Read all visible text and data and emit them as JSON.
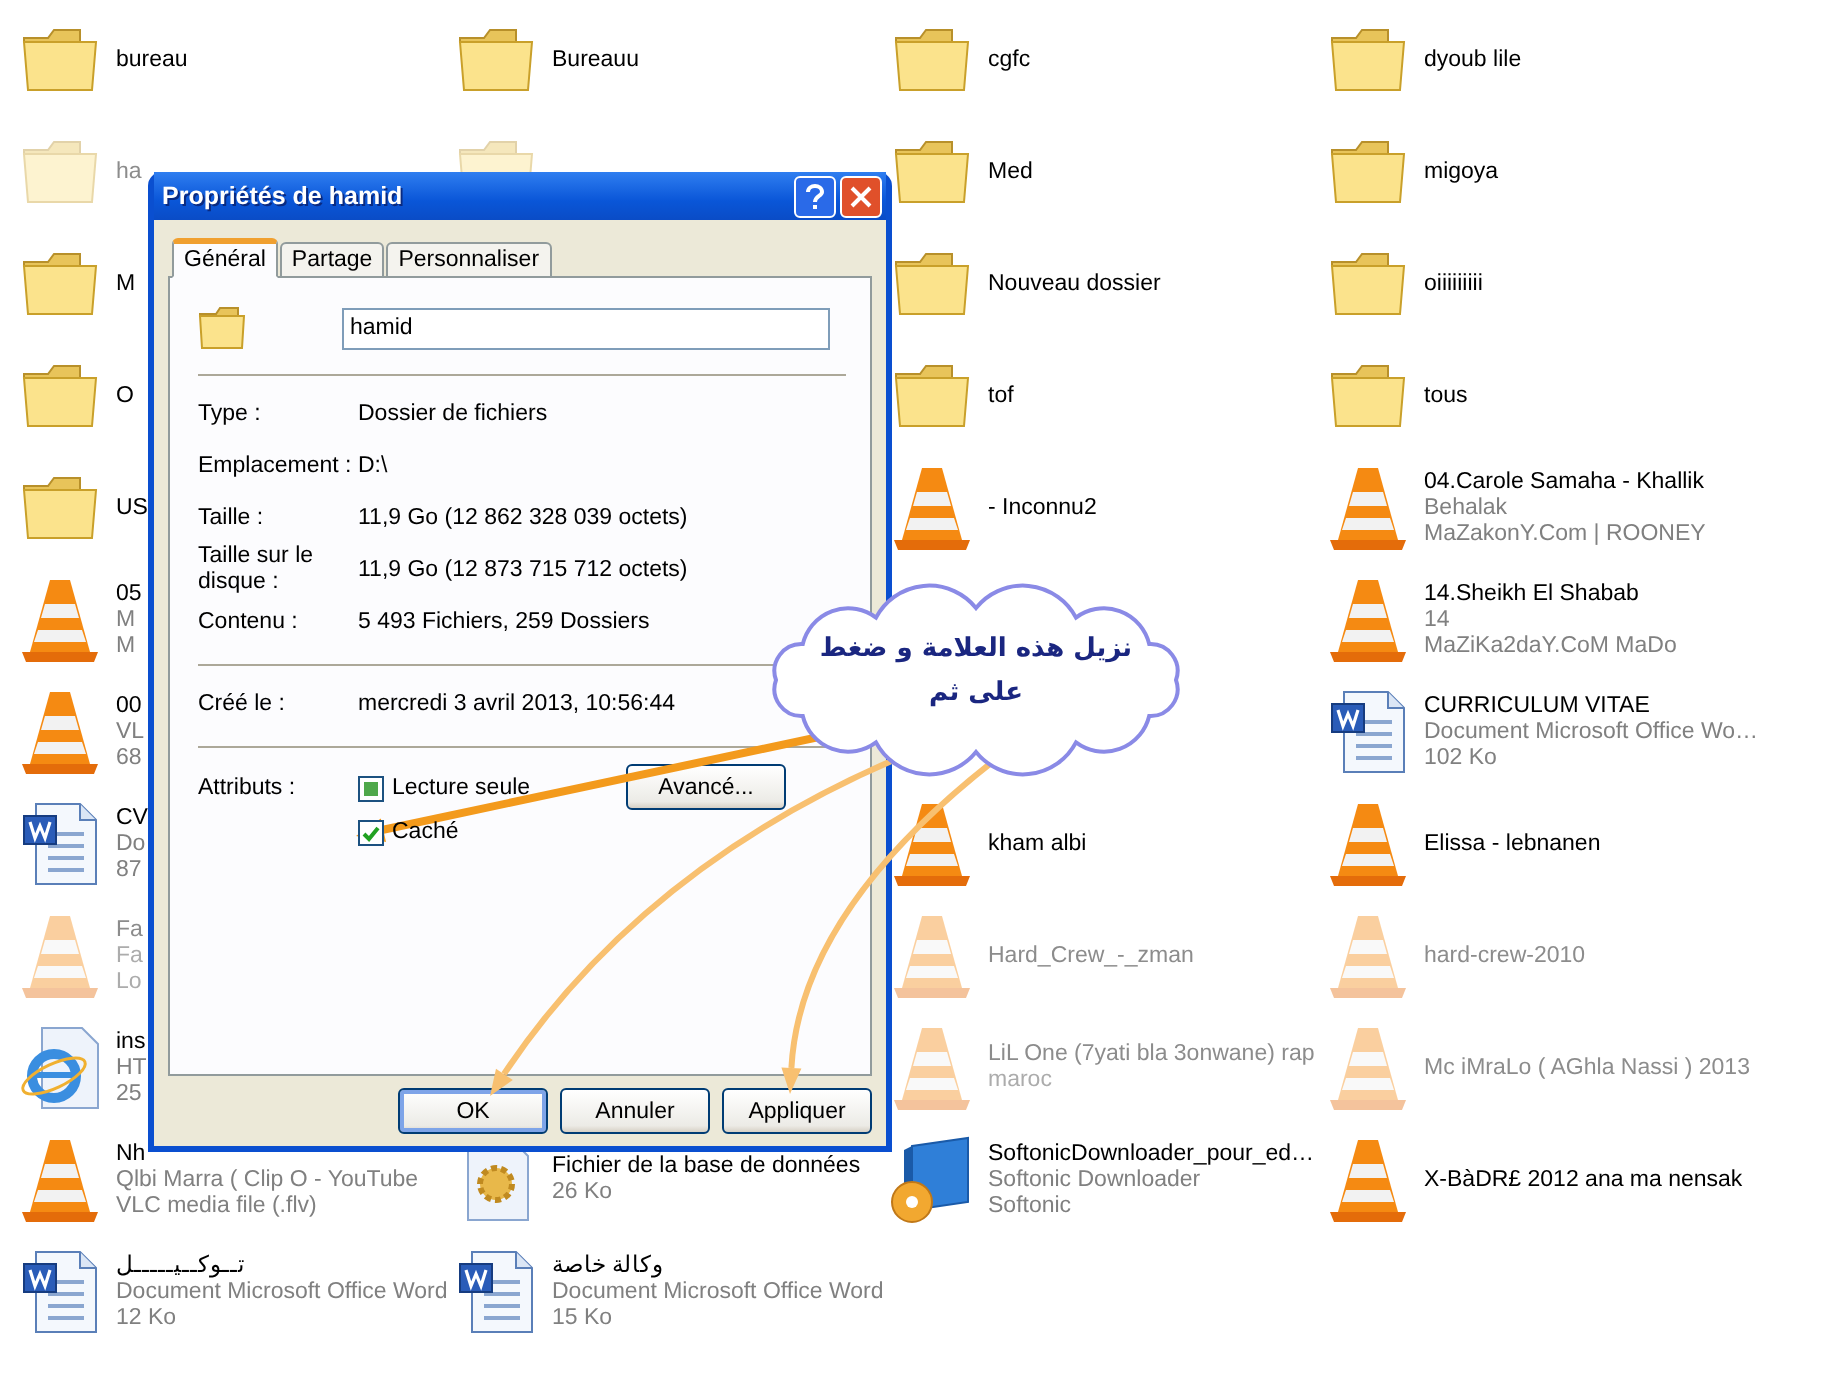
{
  "desktop": {
    "columns": [
      {
        "items": [
          {
            "kind": "folder",
            "hidden": false,
            "lines": [
              "bureau"
            ]
          },
          {
            "kind": "folder",
            "hidden": true,
            "lines": [
              "ha"
            ]
          },
          {
            "kind": "folder",
            "hidden": false,
            "lines": [
              "M"
            ]
          },
          {
            "kind": "folder",
            "hidden": false,
            "lines": [
              "O"
            ]
          },
          {
            "kind": "folder",
            "hidden": false,
            "lines": [
              "US"
            ]
          },
          {
            "kind": "media",
            "hidden": false,
            "lines": [
              "05",
              "M",
              "M"
            ]
          },
          {
            "kind": "media",
            "hidden": false,
            "lines": [
              "00",
              "VL",
              "68"
            ]
          },
          {
            "kind": "document",
            "hidden": false,
            "lines": [
              "CV",
              "Do",
              "87"
            ]
          },
          {
            "kind": "media",
            "hidden": true,
            "lines": [
              "Fa",
              "Fa",
              "Lo"
            ]
          },
          {
            "kind": "webpage",
            "hidden": false,
            "lines": [
              "ins",
              "HT",
              "25"
            ]
          },
          {
            "kind": "media",
            "hidden": false,
            "lines": [
              "Nh",
              "Qlbi Marra ( Clip O - YouTube",
              "VLC media file (.flv)"
            ]
          },
          {
            "kind": "document",
            "hidden": false,
            "lines": [
              "تــوكــيـــــل",
              "Document Microsoft Office Word",
              "12 Ko"
            ]
          }
        ]
      },
      {
        "items": [
          {
            "kind": "folder",
            "hidden": false,
            "lines": [
              "Bureauu"
            ]
          },
          {
            "kind": "folder",
            "hidden": true
          },
          {
            "kind": "database",
            "hidden": false,
            "lines": [
              "Fichier de la base de données",
              "26 Ko"
            ]
          },
          {
            "kind": "document",
            "hidden": false,
            "lines": [
              "وكالة خاصة",
              "Document Microsoft Office Word",
              "15 Ko"
            ]
          }
        ]
      },
      {
        "items": [
          {
            "kind": "folder",
            "hidden": false,
            "lines": [
              "cgfc"
            ]
          },
          {
            "kind": "folder",
            "hidden": false,
            "lines": [
              "Med"
            ]
          },
          {
            "kind": "folder",
            "hidden": false,
            "lines": [
              "Nouveau dossier"
            ]
          },
          {
            "kind": "folder",
            "hidden": false,
            "lines": [
              "tof"
            ]
          },
          {
            "kind": "media",
            "hidden": false,
            "lines": [
              "- Inconnu2"
            ]
          },
          {
            "kind": "media",
            "hidden": false,
            "lines": [
              "kham albi"
            ]
          },
          {
            "kind": "media",
            "hidden": true,
            "lines": [
              "Hard_Crew_-_zman"
            ]
          },
          {
            "kind": "media",
            "hidden": true,
            "lines": [
              "LiL One (7yati bla 3onwane) rap",
              "maroc"
            ]
          },
          {
            "kind": "installer",
            "hidden": false,
            "lines": [
              "SoftonicDownloader_pour_ed…",
              "Softonic Downloader",
              "Softonic"
            ]
          }
        ]
      },
      {
        "items": [
          {
            "kind": "folder",
            "hidden": false,
            "lines": [
              "dyoub lile"
            ]
          },
          {
            "kind": "folder",
            "hidden": false,
            "lines": [
              "migoya"
            ]
          },
          {
            "kind": "folder",
            "hidden": false,
            "lines": [
              "oiiiiiiiii"
            ]
          },
          {
            "kind": "folder",
            "hidden": false,
            "lines": [
              "tous"
            ]
          },
          {
            "kind": "media",
            "hidden": false,
            "lines": [
              "04.Carole Samaha - Khallik",
              "Behalak",
              "MaZakonY.Com | ROONEY"
            ]
          },
          {
            "kind": "media",
            "hidden": false,
            "lines": [
              "14.Sheikh El Shabab",
              "14",
              "MaZiKa2daY.CoM MaDo"
            ]
          },
          {
            "kind": "document",
            "hidden": false,
            "lines": [
              "CURRICULUM VITAE",
              "Document Microsoft Office Wo…",
              "102 Ko"
            ]
          },
          {
            "kind": "media",
            "hidden": false,
            "lines": [
              "Elissa - lebnanen"
            ]
          },
          {
            "kind": "media",
            "hidden": true,
            "lines": [
              "hard-crew-2010"
            ]
          },
          {
            "kind": "media",
            "hidden": true,
            "lines": [
              "Mc  iMraLo ( AGhla Nassi ) 2013"
            ]
          },
          {
            "kind": "media",
            "hidden": false,
            "lines": [
              "X-BàDR£ 2012  ana ma nensak"
            ]
          }
        ]
      }
    ]
  },
  "dialog": {
    "title": "Propriétés de hamid",
    "tabs": [
      {
        "label": "Général",
        "selected": true
      },
      {
        "label": "Partage",
        "selected": false
      },
      {
        "label": "Personnaliser",
        "selected": false
      }
    ],
    "name_field": {
      "value": "hamid"
    },
    "sections": [
      [
        {
          "label": "Type :",
          "value": "Dossier de fichiers"
        },
        {
          "label": "Emplacement :",
          "value": "D:\\"
        },
        {
          "label": "Taille :",
          "value": "11,9 Go (12 862 328 039 octets)"
        },
        {
          "label": "Taille sur le disque :",
          "value": "11,9 Go (12 873 715 712 octets)"
        },
        {
          "label": "Contenu :",
          "value": "5 493 Fichiers, 259 Dossiers"
        }
      ],
      [
        {
          "label": "Créé le :",
          "value": "mercredi 3 avril 2013, 10:56:44"
        }
      ]
    ],
    "attributes": {
      "label": "Attributs :",
      "options": [
        {
          "label": "Lecture seule",
          "checked": false,
          "indeterminate": true
        },
        {
          "label": "Caché",
          "checked": true,
          "indeterminate": false
        }
      ],
      "advanced_button": "Avancé..."
    },
    "buttons": [
      {
        "label": "OK",
        "default": true
      },
      {
        "label": "Annuler",
        "default": false
      },
      {
        "label": "Appliquer",
        "default": false
      }
    ]
  },
  "callout": {
    "lines": [
      "نزيل هذه العلامة و ضغط",
      "على  ثم"
    ]
  }
}
